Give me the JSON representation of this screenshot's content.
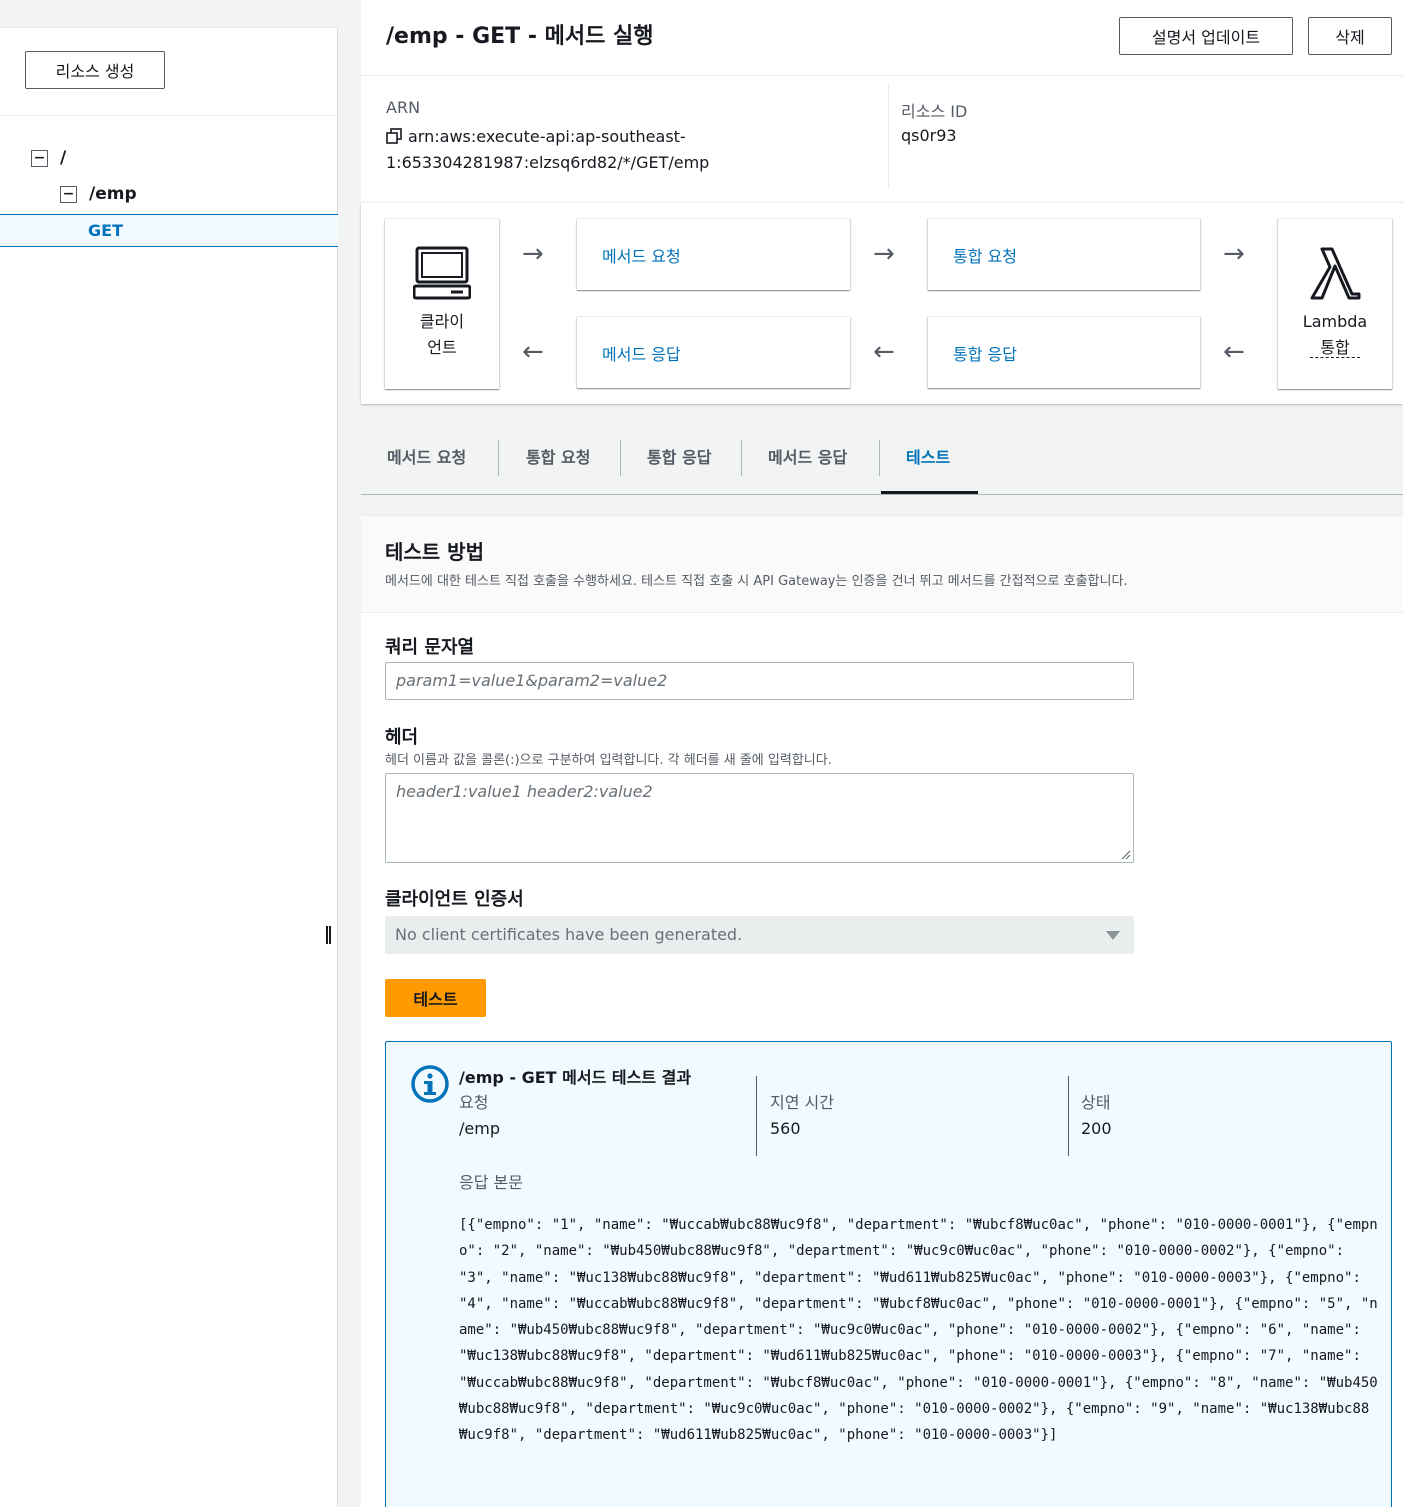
{
  "sidebar": {
    "create_resource_label": "리소스 생성",
    "tree": {
      "root": "/",
      "emp": "/emp",
      "get": "GET"
    }
  },
  "header": {
    "title": "/emp - GET - 메서드 실행",
    "update_docs_label": "설명서 업데이트",
    "delete_label": "삭제"
  },
  "arn": {
    "arn_label": "ARN",
    "arn_value_line1": "arn:aws:execute-api:ap-southeast-",
    "arn_value_line2": "1:653304281987:elzsq6rd82/*/GET/emp",
    "resource_id_label": "리소스 ID",
    "resource_id_value": "qs0r93"
  },
  "flow": {
    "client_line1": "클라이",
    "client_line2": "언트",
    "method_request": "메서드 요청",
    "integration_request": "통합 요청",
    "method_response": "메서드 응답",
    "integration_response": "통합 응답",
    "lambda_line1": "Lambda",
    "lambda_line2": "통합"
  },
  "tabs": [
    {
      "label": "메서드 요청"
    },
    {
      "label": "통합 요청"
    },
    {
      "label": "통합 응답"
    },
    {
      "label": "메서드 응답"
    },
    {
      "label": "테스트"
    }
  ],
  "test": {
    "title": "테스트 방법",
    "description": "메서드에 대한 테스트 직접 호출을 수행하세요. 테스트 직접 호출 시 API Gateway는 인증을 건너 뛰고 메서드를 간접적으로 호출합니다.",
    "query_label": "쿼리 문자열",
    "query_placeholder": "param1=value1&param2=value2",
    "headers_label": "헤더",
    "headers_description": "헤더 이름과 값을 콜론(:)으로 구분하여 입력합니다. 각 헤더를 새 줄에 입력합니다.",
    "headers_placeholder": "header1:value1 header2:value2",
    "cert_label": "클라이언트 인증서",
    "cert_value": "No client certificates have been generated.",
    "test_button": "테스트"
  },
  "result": {
    "title": "/emp - GET 메서드 테스트 결과",
    "request_label": "요청",
    "request_value": "/emp",
    "latency_label": "지연 시간",
    "latency_value": "560",
    "status_label": "상태",
    "status_value": "200",
    "body_label": "응답 본문",
    "body": "[{\"empno\": \"1\", \"name\": \"₩uccab₩ubc88₩uc9f8\", \"department\": \"₩ubcf8₩uc0ac\", \"phone\": \"010-0000-0001\"}, {\"empno\": \"2\", \"name\": \"₩ub450₩ubc88₩uc9f8\", \"department\": \"₩uc9c0₩uc0ac\", \"phone\": \"010-0000-0002\"}, {\"empno\": \"3\", \"name\": \"₩uc138₩ubc88₩uc9f8\", \"department\": \"₩ud611₩ub825₩uc0ac\", \"phone\": \"010-0000-0003\"}, {\"empno\": \"4\", \"name\": \"₩uccab₩ubc88₩uc9f8\", \"department\": \"₩ubcf8₩uc0ac\", \"phone\": \"010-0000-0001\"}, {\"empno\": \"5\", \"name\": \"₩ub450₩ubc88₩uc9f8\", \"department\": \"₩uc9c0₩uc0ac\", \"phone\": \"010-0000-0002\"}, {\"empno\": \"6\", \"name\": \"₩uc138₩ubc88₩uc9f8\", \"department\": \"₩ud611₩ub825₩uc0ac\", \"phone\": \"010-0000-0003\"}, {\"empno\": \"7\", \"name\": \"₩uccab₩ubc88₩uc9f8\", \"department\": \"₩ubcf8₩uc0ac\", \"phone\": \"010-0000-0001\"}, {\"empno\": \"8\", \"name\": \"₩ub450₩ubc88₩uc9f8\", \"department\": \"₩uc9c0₩uc0ac\", \"phone\": \"010-0000-0002\"}, {\"empno\": \"9\", \"name\": \"₩uc138₩ubc88₩uc9f8\", \"department\": \"₩ud611₩ub825₩uc0ac\", \"phone\": \"010-0000-0003\"}]"
  },
  "colors": {
    "link": "#0073bb",
    "primary_button": "#ff9900",
    "info_bg": "#f1faff"
  }
}
